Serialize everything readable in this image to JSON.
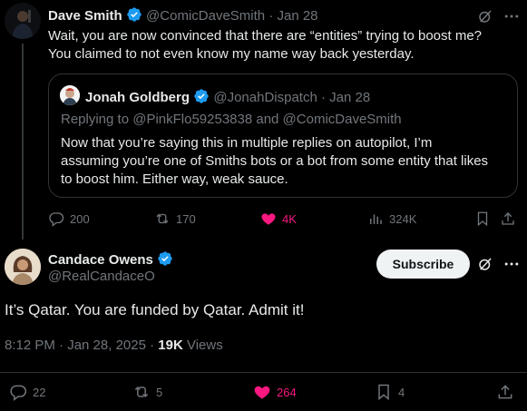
{
  "parent_tweet": {
    "author_name": "Dave Smith",
    "handle": "@ComicDaveSmith",
    "dot": "·",
    "date": "Jan 28",
    "text_line1": "Wait, you are now convinced that there are “entities” trying to boost me?",
    "text_line2": "You claimed to not even know my name way back yesterday.",
    "quoted": {
      "author_name": "Jonah Goldberg",
      "handle": "@JonahDispatch",
      "dot": "·",
      "date": "Jan 28",
      "replying_to": "Replying to @PinkFlo59253838 and @ComicDaveSmith",
      "text_line1": "Now that you’re saying this in multiple replies on autopilot, I’m",
      "text_line2": "assuming you’re one of Smiths bots or a bot from some entity that likes",
      "text_line3": "to boost him. Either way, weak sauce."
    },
    "stats": {
      "replies": "200",
      "reposts": "170",
      "likes": "4K",
      "views": "324K"
    }
  },
  "main_tweet": {
    "author_name": "Candace Owens",
    "handle": "@RealCandaceO",
    "subscribe_label": "Subscribe",
    "text": "It’s Qatar. You are funded by Qatar. Admit it!",
    "timestamp": "8:12 PM · Jan 28, 2025 · ",
    "views_count": "19K",
    "views_label": " Views",
    "stats": {
      "replies": "22",
      "reposts": "5",
      "likes": "264",
      "bookmarks": "4"
    }
  },
  "icons": [
    "verified-badge-icon",
    "grok-icon",
    "more-icon",
    "reply-icon",
    "repost-icon",
    "like-icon",
    "views-icon",
    "bookmark-icon",
    "share-icon"
  ],
  "colors": {
    "background": "#000000",
    "text": "#e7e9ea",
    "muted": "#71767b",
    "verified": "#1d9bf0",
    "like": "#f91880",
    "border": "#2f3336",
    "subscribe_bg": "#eff3f4"
  }
}
